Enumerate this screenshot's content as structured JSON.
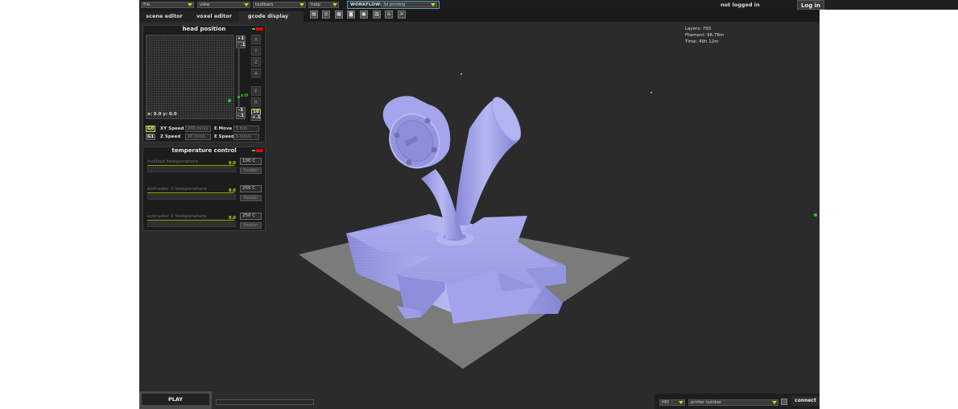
{
  "login": {
    "label": "Log in",
    "status": "not logged in"
  },
  "menu": [
    {
      "label": "file"
    },
    {
      "label": "view"
    },
    {
      "label": "toolbars"
    },
    {
      "label": "help"
    }
  ],
  "workflow": {
    "label": "WORKFLOW:",
    "value": "3d printing"
  },
  "tabs": [
    {
      "label": "scene editor"
    },
    {
      "label": "voxel editor"
    },
    {
      "label": "gcode display"
    }
  ],
  "head_position": {
    "title": "head position",
    "coords": "x: 0.0 y: 0.0",
    "axes": [
      "X",
      "Y",
      "Z",
      "A"
    ],
    "axes2": [
      "E",
      "R"
    ],
    "z_readout": "z:0",
    "step_top": [
      "+1",
      "+.1"
    ],
    "step_bottom": [
      "-1",
      "-.1"
    ],
    "step_mid": [
      "10",
      "+.1"
    ],
    "g0": "G0",
    "g1": "G1",
    "xy_speed_label": "XY Speed",
    "xy_speed": "200 mm/s",
    "z_speed_label": "Z Speed",
    "z_speed": "20 mm/s",
    "e_move_label": "E Move",
    "e_move": "5 mm",
    "e_speed_label": "E Speed",
    "e_speed": "5 mm/s"
  },
  "temperature": {
    "title": "temperature control",
    "rows": [
      {
        "label": "hotbed temperature",
        "value": "0.0",
        "target": "100 C",
        "button": "heater"
      },
      {
        "label": "extruder 1 temperature",
        "value": "0.0",
        "target": "250 C",
        "button": "heater"
      },
      {
        "label": "extruder 2 temperature",
        "value": "0.0",
        "target": "250 C",
        "button": "heater"
      }
    ]
  },
  "stats": {
    "layers": "Layers: 793",
    "filament": "Filament: 96.78m",
    "time": "Time: 49h 12m"
  },
  "bottom": {
    "play": "PLAY",
    "port": "HID",
    "printer": "printer number",
    "connect": "connect"
  },
  "colors": {
    "background": "#2b2b2b",
    "model": "#9fa0e6",
    "bed": "#7a7a7a",
    "accent": "#c8e000"
  }
}
